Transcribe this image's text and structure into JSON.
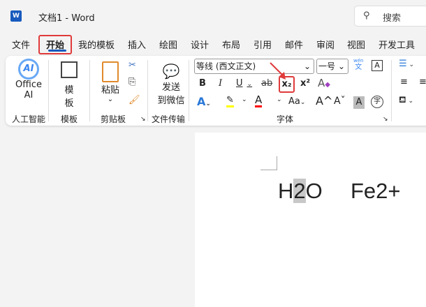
{
  "title_bar": {
    "app_icon": "word-icon",
    "logo_letter": "W",
    "title": "文档1  -  Word",
    "search_placeholder": "搜索"
  },
  "tabs": [
    {
      "label": "文件"
    },
    {
      "label": "开始",
      "active": true
    },
    {
      "label": "我的模板"
    },
    {
      "label": "插入"
    },
    {
      "label": "绘图"
    },
    {
      "label": "设计"
    },
    {
      "label": "布局"
    },
    {
      "label": "引用"
    },
    {
      "label": "邮件"
    },
    {
      "label": "审阅"
    },
    {
      "label": "视图"
    },
    {
      "label": "开发工具"
    }
  ],
  "ribbon": {
    "ai": {
      "icon_text": "AI",
      "label1": "Office",
      "label2": "AI",
      "group": "人工智能"
    },
    "template": {
      "label1": "模",
      "label2": "板",
      "group": "模板"
    },
    "clipboard": {
      "paste1": "粘贴",
      "paste_arrow": "⌄",
      "group": "剪贴板"
    },
    "wechat": {
      "label1": "发送",
      "label2": "到微信",
      "group": "文件传输"
    },
    "font": {
      "font_name": "等线 (西文正文)",
      "font_size": "一号",
      "group": "字体",
      "bold": "B",
      "italic": "I",
      "underline": "U",
      "strike": "ab",
      "subscript": "x₂",
      "superscript": "x²",
      "phonetic_top": "wén",
      "phonetic_bottom": "文",
      "grow": "A^",
      "shrink": "Aˇ",
      "case": "Aa",
      "shade": "A",
      "char_border": "A",
      "enclose": "字"
    },
    "colors": {
      "highlight": "#ffff00",
      "font_color": "#ff0000",
      "accent": "#e03a3a"
    }
  },
  "document": {
    "text1_a": "H",
    "text1_sel": "2",
    "text1_b": "O",
    "text2": "Fe2+"
  }
}
